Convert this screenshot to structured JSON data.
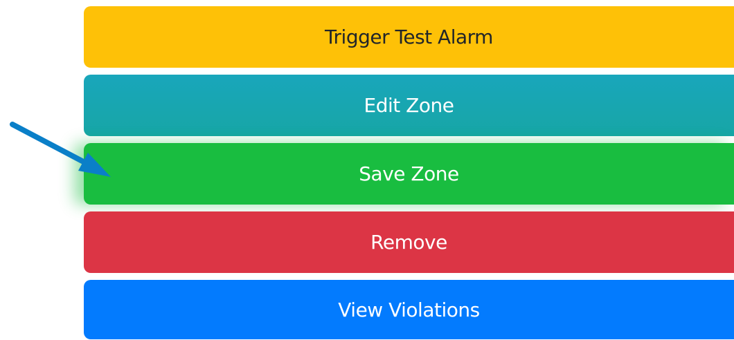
{
  "buttons": {
    "trigger_test_alarm": "Trigger Test Alarm",
    "edit_zone": "Edit Zone",
    "save_zone": "Save Zone",
    "remove": "Remove",
    "view_violations": "View Violations"
  },
  "colors": {
    "warning": "#fec107",
    "info": "#17a2b8",
    "success": "#19bd40",
    "danger": "#dc3545",
    "primary": "#037bfe",
    "annotation_arrow": "#0a7fc8"
  },
  "annotation": {
    "icon": "arrow-pointer-icon",
    "target": "save_zone"
  }
}
